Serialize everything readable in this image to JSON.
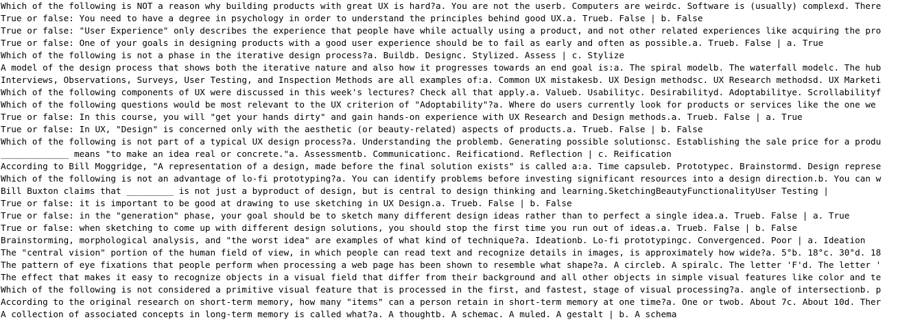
{
  "document": {
    "lines": [
      "Which of the following is NOT a reason why building products with great UX is hard?a. You are not the userb. Computers are weirdc. Software is (usually) complexd. There",
      "True or false: You need to have a degree in psychology in order to understand the principles behind good UX.a. Trueb. False | b. False",
      "True or false: \"User Experience\" only describes the experience that people have while actually using a product, and not other related experiences like acquiring the pro",
      "True or false: One of your goals in designing products with a good user experience should be to fail as early and often as possible.a. Trueb. False | a. True",
      "Which of the following is not a phase in the iterative design process?a. Buildb. Designc. Stylized. Assess | c. Stylize",
      "A model of the design process that shows both the iterative nature and also how it progresses towards an end goal is:a. The spiral modelb. The waterfall modelc. The hub",
      "Interviews, Observations, Surveys, User Testing, and Inspection Methods are all examples of:a. Common UX mistakesb. UX Design methodsc. UX Research methodsd. UX Marketi",
      "Which of the following components of UX were discussed in this week's lectures? Check all that apply.a. Valueb. Usabilityc. Desirabilityd. Adoptabilitye. Scrollabilityf",
      "Which of the following questions would be most relevant to the UX criterion of \"Adoptability\"?a. Where do users currently look for products or services like the one we",
      "True or false: In this course, you will \"get your hands dirty\" and gain hands-on experience with UX Research and Design methods.a. Trueb. False | a. True",
      "True or false: In UX, \"Design\" is concerned only with the aesthetic (or beauty-related) aspects of products.a. Trueb. False | b. False",
      "Which of the following is not part of a typical UX design process?a. Understanding the problemb. Generating possible solutionsc. Establishing the sale price for a produ",
      "_____________ means \"to make an idea real or concrete.\"a. Assessmentb. Communicationc. Reificationd. Reflection | c. Reification",
      "According to Bill Moggridge, \"A representation of a design, made before the final solution exists\" is called a:a. Time capsuleb. Prototypec. Brainstormd. Design represe",
      "Which of the following is not an advantage of lo-fi prototyping?a. You can identify problems before investing significant resources into a design direction.b. You can w",
      "Bill Buxton claims that _________ is not just a byproduct of design, but is central to design thinking and learning.SketchingBeautyFunctionalityUser Testing |",
      "True or false: it is important to be good at drawing to use sketching in UX Design.a. Trueb. False | b. False",
      "True or false: in the \"generation\" phase, your goal should be to sketch many different design ideas rather than to perfect a single idea.a. Trueb. False | a. True",
      "True or false: when sketching to come up with different design solutions, you should stop the first time you run out of ideas.a. Trueb. False | b. False",
      "Brainstorming, morphological analysis, and \"the worst idea\" are examples of what kind of technique?a. Ideationb. Lo-fi prototypingc. Convergenced. Poor | a. Ideation",
      "The \"central vision\" portion of the human field of view, in which people can read text and recognize details in images, is approximately how wide?a. 5°b. 18°c. 30°d. 18",
      "The pattern of eye fixations that people perform when processing a web page has been shown to resemble what shape?a. A circleb. A spiralc. The letter 'F'd. The letter '",
      "The effect that makes it easy to recognize objects in a visual field that differ from their background and all other objects in simple visual features like color and te",
      "Which of the following is not considered a primitive visual feature that is processed in the first, and fastest, stage of visual processing?a. angle of intersectionb. p",
      "According to the original research on short-term memory, how many \"items\" can a person retain in short-term memory at one time?a. One or twob. About 7c. About 10d. Ther",
      "A collection of associated concepts in long-term memory is called what?a. A thoughtb. A schemac. A muled. A gestalt | b. A schema"
    ]
  }
}
